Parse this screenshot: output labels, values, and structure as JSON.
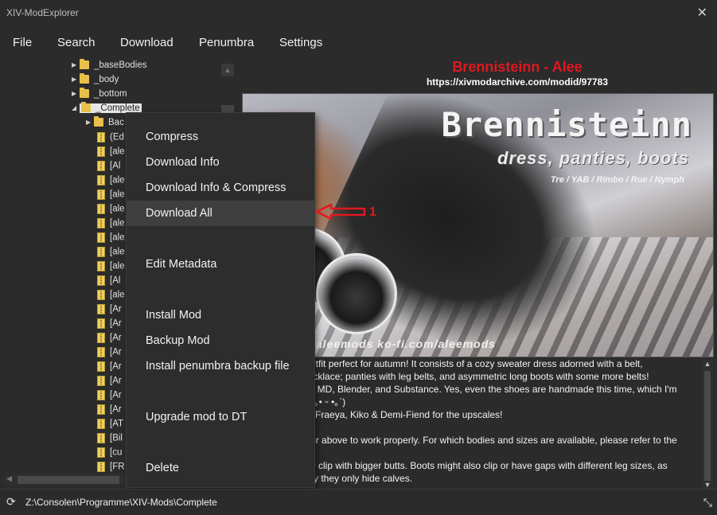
{
  "app": {
    "title": "XIV-ModExplorer",
    "close_glyph": "✕"
  },
  "menu": [
    "File",
    "Search",
    "Download",
    "Penumbra",
    "Settings"
  ],
  "tree": {
    "folders": [
      {
        "label": "_baseBodies",
        "expanded": false
      },
      {
        "label": "_body",
        "expanded": false
      },
      {
        "label": "_bottom",
        "expanded": false
      },
      {
        "label": "_Complete",
        "expanded": true,
        "selected": true
      }
    ],
    "children": [
      {
        "type": "folder",
        "label": "Bac"
      },
      {
        "type": "zip",
        "label": "(Ed"
      },
      {
        "type": "zip",
        "label": "[ale"
      },
      {
        "type": "zip",
        "label": "[Al"
      },
      {
        "type": "zip",
        "label": "[ale"
      },
      {
        "type": "zip",
        "label": "[ale"
      },
      {
        "type": "zip",
        "label": "[ale"
      },
      {
        "type": "zip",
        "label": "[ale"
      },
      {
        "type": "zip",
        "label": "[ale"
      },
      {
        "type": "zip",
        "label": "[ale"
      },
      {
        "type": "zip",
        "label": "[ale"
      },
      {
        "type": "zip",
        "label": "[Al"
      },
      {
        "type": "zip",
        "label": "[ale"
      },
      {
        "type": "zip",
        "label": "[Ar"
      },
      {
        "type": "zip",
        "label": "[Ar"
      },
      {
        "type": "zip",
        "label": "[Ar"
      },
      {
        "type": "zip",
        "label": "[Ar"
      },
      {
        "type": "zip",
        "label": "[Ar"
      },
      {
        "type": "zip",
        "label": "[Ar"
      },
      {
        "type": "zip",
        "label": "[Ar"
      },
      {
        "type": "zip",
        "label": "[Ar"
      },
      {
        "type": "zip",
        "label": "[AT"
      },
      {
        "type": "zip",
        "label": "[Bil"
      },
      {
        "type": "zip",
        "label": "[cu"
      },
      {
        "type": "zip",
        "label": "[FR"
      }
    ]
  },
  "context_menu": {
    "items": [
      {
        "label": "Compress",
        "hover": false
      },
      {
        "label": "Download Info",
        "hover": false
      },
      {
        "label": "Download Info & Compress",
        "hover": false
      },
      {
        "label": "Download All",
        "hover": true
      },
      {
        "label": "",
        "hover": false
      },
      {
        "label": "Edit Metadata",
        "hover": false
      },
      {
        "label": "",
        "hover": false
      },
      {
        "label": "Install Mod",
        "hover": false
      },
      {
        "label": "Backup Mod",
        "hover": false
      },
      {
        "label": "Install penumbra backup file",
        "hover": false
      },
      {
        "label": "",
        "hover": false
      },
      {
        "label": "Upgrade mod to DT",
        "hover": false
      },
      {
        "label": "",
        "hover": false
      },
      {
        "label": "Delete",
        "hover": false
      }
    ]
  },
  "annotation": {
    "number": "1",
    "color": "#e0181f"
  },
  "mod": {
    "title": "Brennisteinn - Alee",
    "url": "https://xivmodarchive.com/modid/97783",
    "image": {
      "brand": "Brennisteinn",
      "subtitle": "dress, panties, boots",
      "bodies": "Tre / YAB / Rimbo / Rue / Nymph",
      "social": "om/aleemods    ko-fi.com/aleemods"
    },
    "description": [
      "th outfit perfect for autumn! It consists of a cozy sweater dress adorned with a belt,",
      "n necklace; panties with leg belts, and asymmetric long boots with some more belts!",
      "ch in MD, Blender, and Substance. Yes, even the shoes are handmade this time, which I'm",
      "of! (´｡• ᵕ •｡`)",
      "buz, Fraeya, Kiko & Demi-Fiend for the upscales!",
      "",
      " 2.0 or above to work properly. For which bodies and sizes are available, please refer to the",
      "",
      " likely clip with bigger butts. Boots might also clip or have gaps with different leg sizes, as",
      "metry they only hide calves."
    ]
  },
  "status": {
    "path": "Z:\\Consolen\\Programme\\XIV-Mods\\Complete"
  },
  "colors": {
    "background": "#2b2b2b",
    "menu_bg": "#2d2d2d",
    "hover": "#3f3f3f",
    "accent_red": "#e0181f"
  }
}
